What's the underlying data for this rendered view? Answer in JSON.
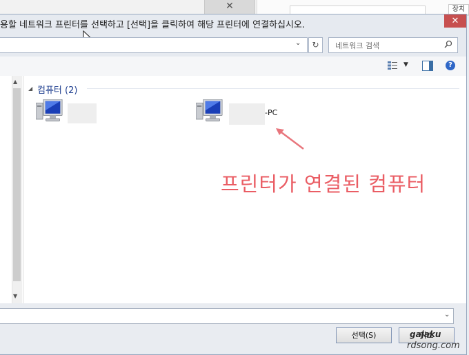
{
  "dialog": {
    "title": "용할 네트워크 프린터를 선택하고 [선택]을 클릭하여 해당 프린터에 연결하십시오.",
    "close_glyph": "✕"
  },
  "background_window": {
    "close_glyph": "✕",
    "button_label": "장치"
  },
  "address_bar": {
    "dropdown_glyph": "⌄",
    "refresh_glyph": "↻"
  },
  "search": {
    "placeholder": "네트워크 검색",
    "icon": "search-icon"
  },
  "toolbar": {
    "view_icon": "view-options-icon",
    "dropdown_glyph": "▼",
    "pane_icon": "preview-pane-icon",
    "help_glyph": "?"
  },
  "group": {
    "label": "컴퓨터 (2)",
    "collapse_glyph": "◢"
  },
  "computers": [
    {
      "name": "",
      "icon": "computer-icon"
    },
    {
      "name": "-PC",
      "icon": "computer-icon"
    }
  ],
  "annotation": {
    "text": "프린터가 연결된 컴퓨터",
    "color": "#ea5d64"
  },
  "bottom": {
    "combo_glyph": "⌄",
    "select_label": "선택(S)",
    "cancel_label": "취소"
  },
  "watermark": {
    "line1": "gajaku",
    "line2": "rdsong.com"
  },
  "scrollbar": {
    "up_glyph": "▲",
    "down_glyph": "▼"
  }
}
